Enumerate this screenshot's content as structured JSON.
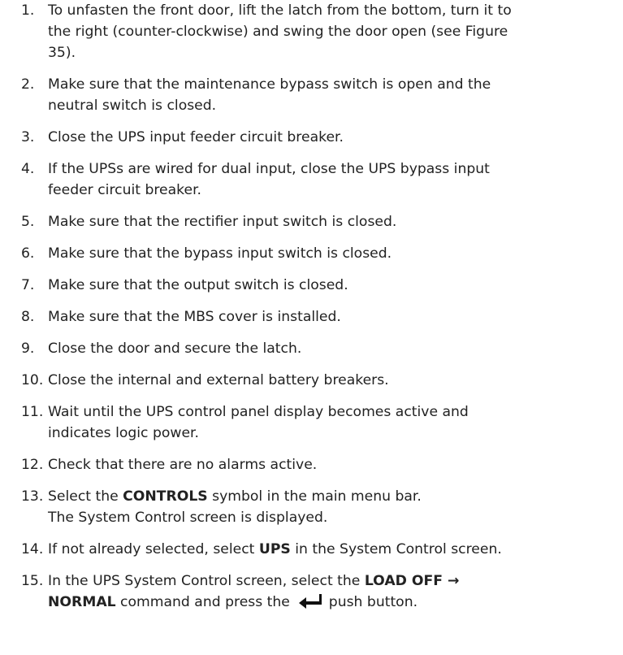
{
  "steps": [
    {
      "num": "1.",
      "lines": [
        "To unfasten the front door, lift the latch from the bottom, turn it to",
        "the right (counter-clockwise) and swing the door open (see Figure",
        "35)."
      ]
    },
    {
      "num": "2.",
      "lines": [
        "Make sure that the maintenance bypass switch is open and the",
        "neutral switch is closed."
      ]
    },
    {
      "num": "3.",
      "lines": [
        "Close the UPS input feeder circuit breaker."
      ]
    },
    {
      "num": "4.",
      "lines": [
        "If the UPSs are wired for dual input, close the UPS bypass input",
        "feeder circuit breaker."
      ]
    },
    {
      "num": "5.",
      "lines": [
        "Make sure that the rectifier input switch is closed."
      ]
    },
    {
      "num": "6.",
      "lines": [
        "Make sure that the bypass input switch is closed."
      ]
    },
    {
      "num": "7.",
      "lines": [
        "Make sure that the output switch is closed."
      ]
    },
    {
      "num": "8.",
      "lines": [
        "Make sure that the MBS cover is installed."
      ]
    },
    {
      "num": "9.",
      "lines": [
        "Close the door and secure the latch."
      ]
    },
    {
      "num": "10.",
      "lines": [
        "Close the internal and external battery breakers."
      ]
    },
    {
      "num": "11.",
      "lines": [
        "Wait until the UPS control panel display becomes active and",
        "indicates logic power."
      ]
    },
    {
      "num": "12.",
      "lines": [
        "Check that there are no alarms active."
      ]
    },
    {
      "num": "13.",
      "line1": {
        "pre": "Select the ",
        "bold": "CONTROLS",
        "post": " symbol in the main menu bar."
      },
      "result": "The System Control screen is displayed."
    },
    {
      "num": "14.",
      "line1": {
        "pre": "If not already selected, select ",
        "bold": "UPS",
        "post": " in the System Control screen."
      }
    },
    {
      "num": "15.",
      "line1": {
        "pre": "In the UPS System Control screen, select the ",
        "bold": "LOAD OFF →"
      },
      "line2": {
        "bold": "NORMAL",
        "mid": " command and press the ",
        "icon": "enter-arrow-icon",
        "post": " push button."
      }
    }
  ]
}
